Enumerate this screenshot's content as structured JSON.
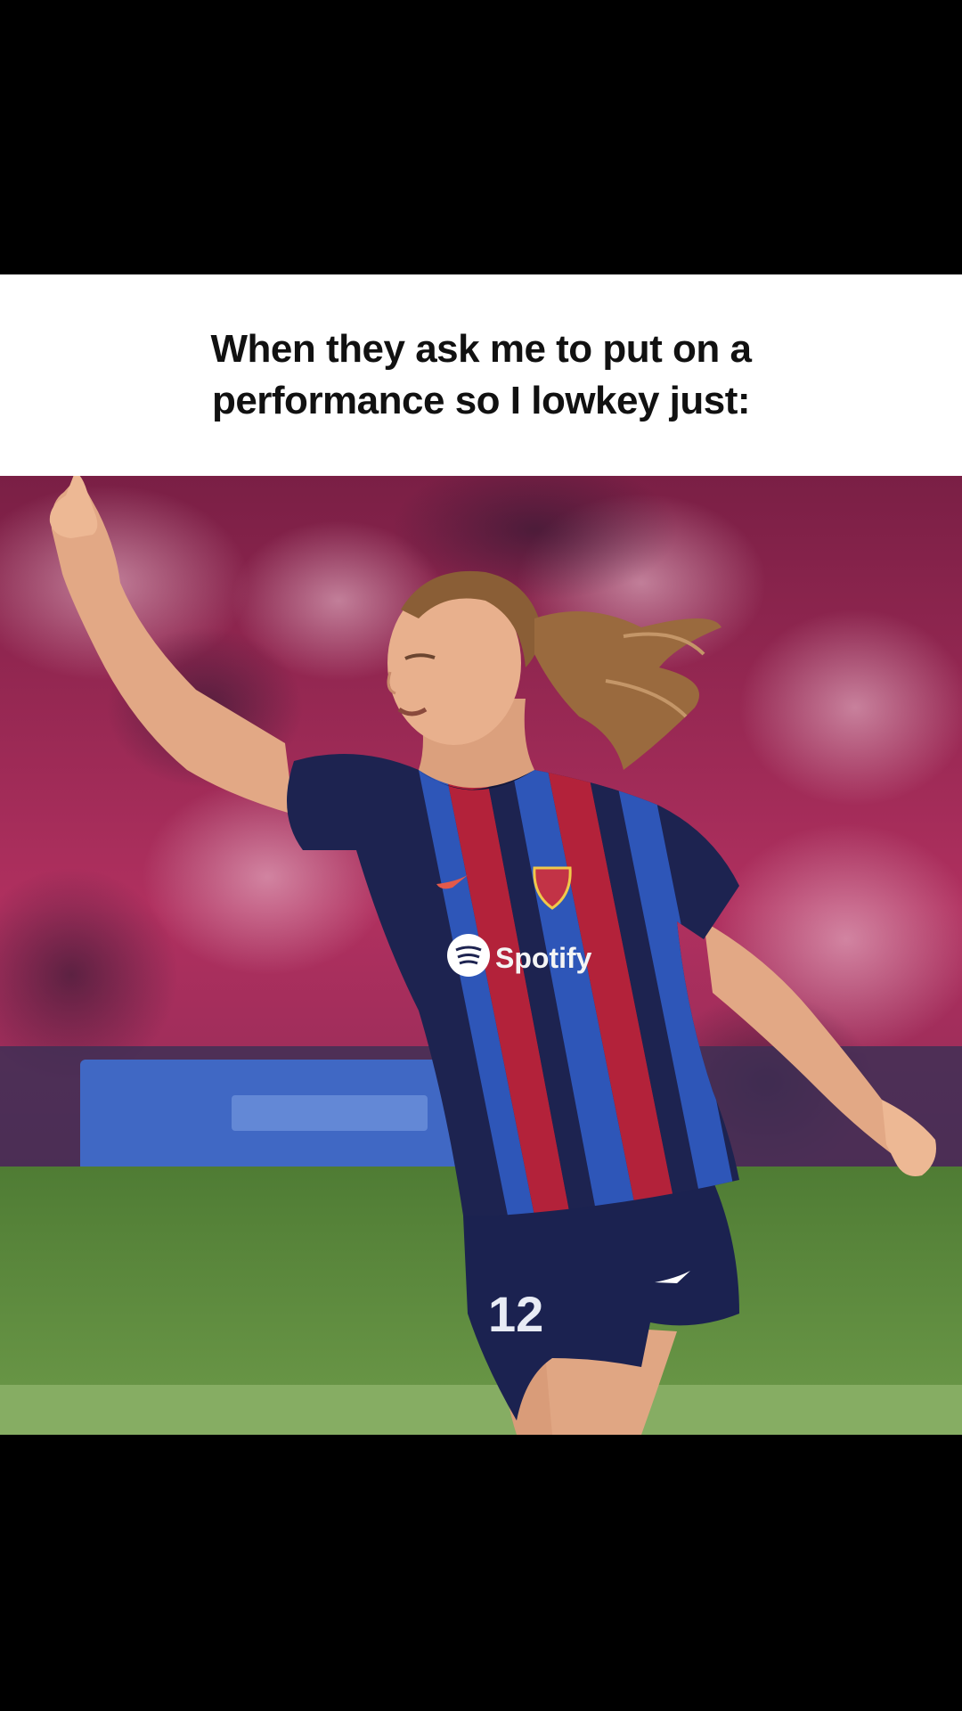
{
  "caption": {
    "text": "When they ask me to put on a performance so I lowkey just:"
  },
  "photo": {
    "shirt_sponsor": "Spotify",
    "shorts_number": "12",
    "colors": {
      "stands": "#b0305f",
      "pitch": "#5d8a3e",
      "jersey_navy": "#1d2350",
      "jersey_blue": "#2e56b8",
      "jersey_red": "#b3223a",
      "skin": "#e8b08d",
      "hair": "#9a6a3e"
    }
  }
}
